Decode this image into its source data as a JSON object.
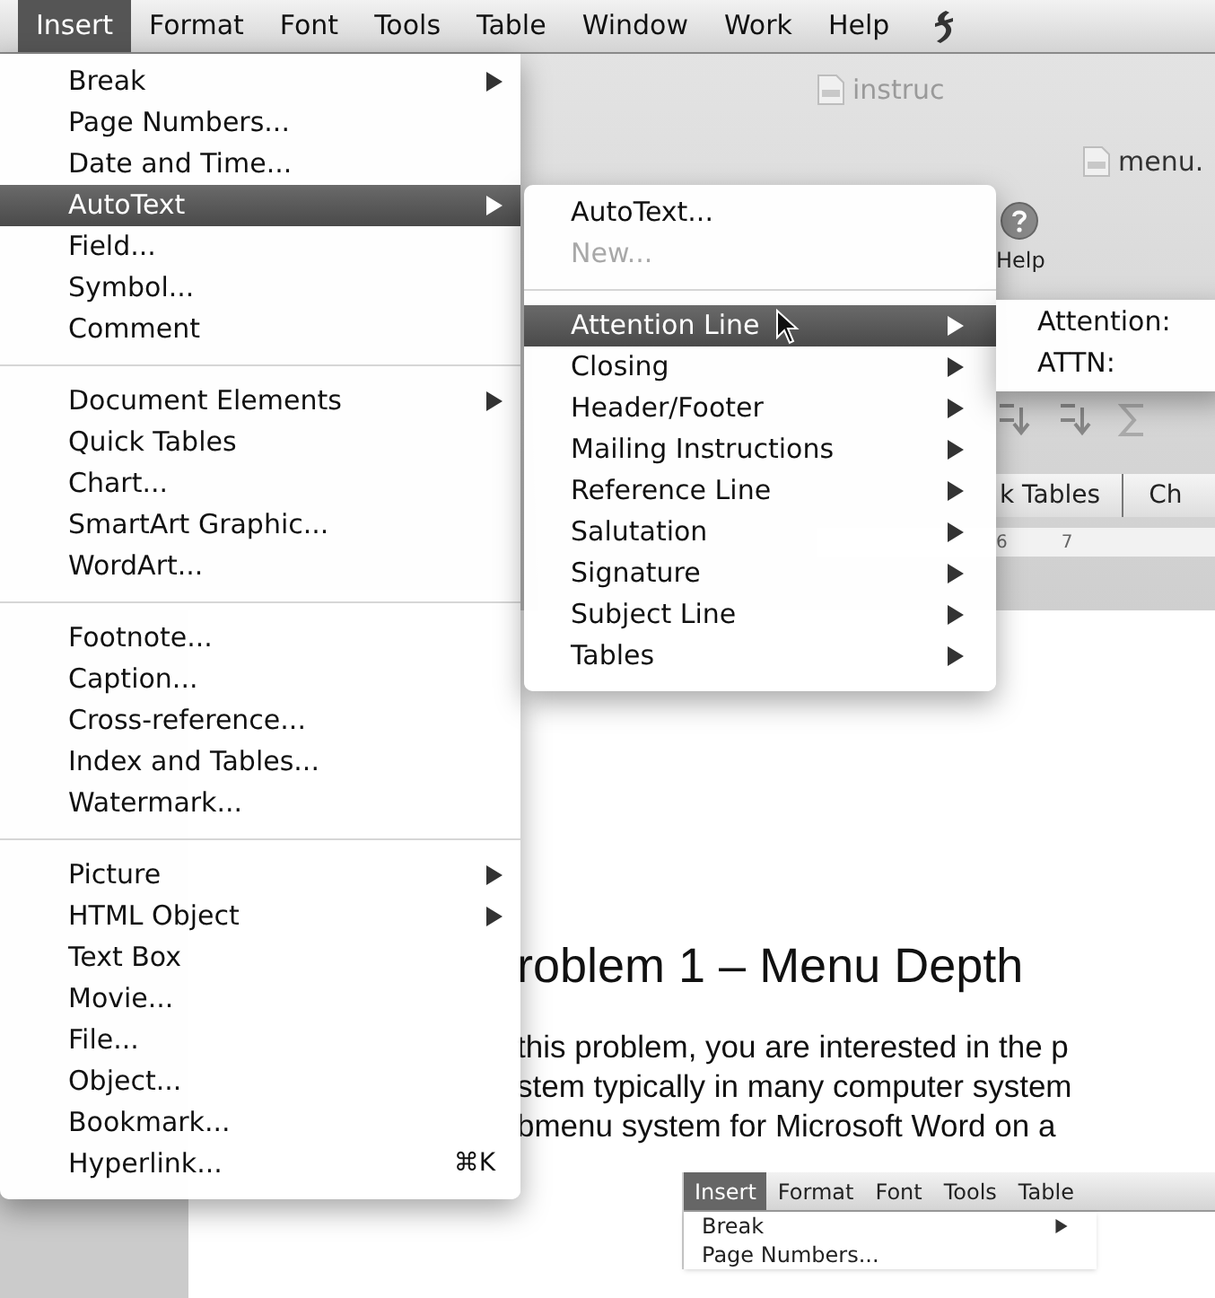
{
  "menu_bar": [
    {
      "label": "Insert",
      "selected": true
    },
    {
      "label": "Format",
      "selected": false
    },
    {
      "label": "Font",
      "selected": false
    },
    {
      "label": "Tools",
      "selected": false
    },
    {
      "label": "Table",
      "selected": false
    },
    {
      "label": "Window",
      "selected": false
    },
    {
      "label": "Work",
      "selected": false
    },
    {
      "label": "Help",
      "selected": false
    }
  ],
  "insert_menu": [
    {
      "kind": "item",
      "label": "Break",
      "submenu": true,
      "selected": false
    },
    {
      "kind": "item",
      "label": "Page Numbers...",
      "submenu": false,
      "selected": false
    },
    {
      "kind": "item",
      "label": "Date and Time...",
      "submenu": false,
      "selected": false
    },
    {
      "kind": "item",
      "label": "AutoText",
      "submenu": true,
      "selected": true
    },
    {
      "kind": "item",
      "label": "Field...",
      "submenu": false,
      "selected": false
    },
    {
      "kind": "item",
      "label": "Symbol...",
      "submenu": false,
      "selected": false
    },
    {
      "kind": "item",
      "label": "Comment",
      "submenu": false,
      "selected": false
    },
    {
      "kind": "separator"
    },
    {
      "kind": "item",
      "label": "Document Elements",
      "submenu": true,
      "selected": false
    },
    {
      "kind": "item",
      "label": "Quick Tables",
      "submenu": false,
      "selected": false
    },
    {
      "kind": "item",
      "label": "Chart...",
      "submenu": false,
      "selected": false
    },
    {
      "kind": "item",
      "label": "SmartArt Graphic...",
      "submenu": false,
      "selected": false
    },
    {
      "kind": "item",
      "label": "WordArt...",
      "submenu": false,
      "selected": false
    },
    {
      "kind": "separator"
    },
    {
      "kind": "item",
      "label": "Footnote...",
      "submenu": false,
      "selected": false
    },
    {
      "kind": "item",
      "label": "Caption...",
      "submenu": false,
      "selected": false
    },
    {
      "kind": "item",
      "label": "Cross-reference...",
      "submenu": false,
      "selected": false
    },
    {
      "kind": "item",
      "label": "Index and Tables...",
      "submenu": false,
      "selected": false
    },
    {
      "kind": "item",
      "label": "Watermark...",
      "submenu": false,
      "selected": false
    },
    {
      "kind": "separator"
    },
    {
      "kind": "item",
      "label": "Picture",
      "submenu": true,
      "selected": false
    },
    {
      "kind": "item",
      "label": "HTML Object",
      "submenu": true,
      "selected": false
    },
    {
      "kind": "item",
      "label": "Text Box",
      "submenu": false,
      "selected": false
    },
    {
      "kind": "item",
      "label": "Movie...",
      "submenu": false,
      "selected": false
    },
    {
      "kind": "item",
      "label": "File...",
      "submenu": false,
      "selected": false
    },
    {
      "kind": "item",
      "label": "Object...",
      "submenu": false,
      "selected": false
    },
    {
      "kind": "item",
      "label": "Bookmark...",
      "submenu": false,
      "selected": false
    },
    {
      "kind": "item",
      "label": "Hyperlink...",
      "submenu": false,
      "selected": false,
      "shortcut": "⌘K"
    }
  ],
  "autotext_menu": [
    {
      "kind": "item",
      "label": "AutoText...",
      "submenu": false,
      "selected": false,
      "disabled": false
    },
    {
      "kind": "item",
      "label": "New...",
      "submenu": false,
      "selected": false,
      "disabled": true
    },
    {
      "kind": "separator"
    },
    {
      "kind": "item",
      "label": "Attention Line",
      "submenu": true,
      "selected": true,
      "disabled": false
    },
    {
      "kind": "item",
      "label": "Closing",
      "submenu": true,
      "selected": false,
      "disabled": false
    },
    {
      "kind": "item",
      "label": "Header/Footer",
      "submenu": true,
      "selected": false,
      "disabled": false
    },
    {
      "kind": "item",
      "label": "Mailing Instructions",
      "submenu": true,
      "selected": false,
      "disabled": false
    },
    {
      "kind": "item",
      "label": "Reference Line",
      "submenu": true,
      "selected": false,
      "disabled": false
    },
    {
      "kind": "item",
      "label": "Salutation",
      "submenu": true,
      "selected": false,
      "disabled": false
    },
    {
      "kind": "item",
      "label": "Signature",
      "submenu": true,
      "selected": false,
      "disabled": false
    },
    {
      "kind": "item",
      "label": "Subject Line",
      "submenu": true,
      "selected": false,
      "disabled": false
    },
    {
      "kind": "item",
      "label": "Tables",
      "submenu": true,
      "selected": false,
      "disabled": false
    }
  ],
  "attention_menu": [
    "Attention:",
    "ATTN:"
  ],
  "ribbon": {
    "document_tab": "instruc",
    "window_title": "menu.",
    "help_label": "Help",
    "quick_tables_button": "k Tables",
    "chart_button": "Ch",
    "ruler_labels": [
      "6",
      "7"
    ]
  },
  "document": {
    "heading": "roblem 1 – Menu Depth",
    "paragraph_lines": [
      "this problem, you are interested in the p",
      "stem typically in many computer system",
      "bmenu system for Microsoft Word on a"
    ]
  },
  "embedded_screenshot": {
    "menu_bar": [
      {
        "label": "Insert",
        "selected": true
      },
      {
        "label": "Format",
        "selected": false
      },
      {
        "label": "Font",
        "selected": false
      },
      {
        "label": "Tools",
        "selected": false
      },
      {
        "label": "Table",
        "selected": false
      }
    ],
    "items": [
      {
        "label": "Break",
        "submenu": true
      },
      {
        "label": "Page Numbers...",
        "submenu": false
      }
    ]
  }
}
